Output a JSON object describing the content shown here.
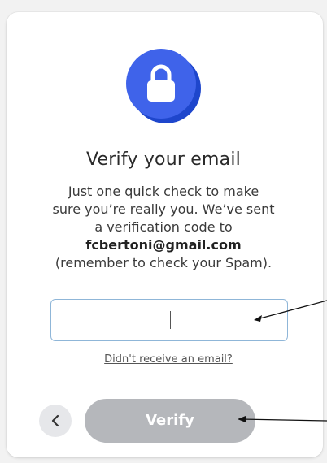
{
  "dialog": {
    "title": "Verify your email",
    "description_lines": [
      "Just one quick check to make",
      "sure you’re really you. We’ve sent",
      "a verification code to"
    ],
    "email": "fcbertoni@gmail.com",
    "spam_note": "(remember to check your Spam).",
    "code_input": {
      "value": "",
      "placeholder": ""
    },
    "resend_link": "Didn't receive an email?",
    "verify_button": "Verify",
    "back_button_icon": "chevron-left-icon",
    "header_icon": "lock-icon"
  },
  "colors": {
    "icon_circle": "#3f63ea",
    "icon_shadow": "#1e46cc",
    "input_border": "#8fb6d8",
    "verify_disabled": "#b5b7bb"
  }
}
